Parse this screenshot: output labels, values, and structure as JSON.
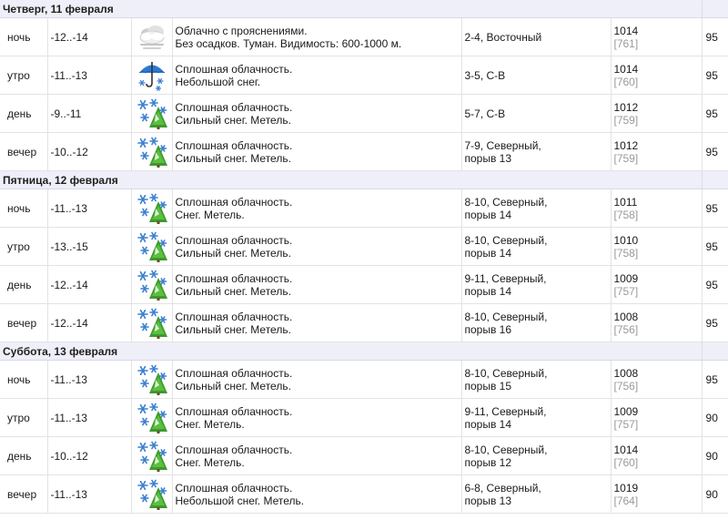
{
  "days": [
    {
      "title": "Четверг, 11 февраля",
      "rows": [
        {
          "time": "ночь",
          "temp": "-12..-14",
          "icon": "cloudy-fog-icon",
          "desc": [
            "Облачно с прояснениями.",
            "Без осадков. Туман. Видимость: 600-1000 м."
          ],
          "wind": [
            "2-4, Восточный"
          ],
          "pressure": "1014",
          "mmhg": "[761]",
          "humidity": "95"
        },
        {
          "time": "утро",
          "temp": "-11..-13",
          "icon": "umbrella-snow-icon",
          "desc": [
            "Сплошная облачность.",
            "Небольшой снег."
          ],
          "wind": [
            "3-5, С-В"
          ],
          "pressure": "1014",
          "mmhg": "[760]",
          "humidity": "95"
        },
        {
          "time": "день",
          "temp": "-9..-11",
          "icon": "snow-blizzard-icon",
          "desc": [
            "Сплошная облачность.",
            "Сильный снег. Метель."
          ],
          "wind": [
            "5-7, С-В"
          ],
          "pressure": "1012",
          "mmhg": "[759]",
          "humidity": "95"
        },
        {
          "time": "вечер",
          "temp": "-10..-12",
          "icon": "snow-blizzard-icon",
          "desc": [
            "Сплошная облачность.",
            "Сильный снег. Метель."
          ],
          "wind": [
            "7-9, Северный,",
            "порыв 13"
          ],
          "pressure": "1012",
          "mmhg": "[759]",
          "humidity": "95"
        }
      ]
    },
    {
      "title": "Пятница, 12 февраля",
      "rows": [
        {
          "time": "ночь",
          "temp": "-11..-13",
          "icon": "snow-blizzard-icon",
          "desc": [
            "Сплошная облачность.",
            "Снег. Метель."
          ],
          "wind": [
            "8-10, Северный,",
            "порыв 14"
          ],
          "pressure": "1011",
          "mmhg": "[758]",
          "humidity": "95"
        },
        {
          "time": "утро",
          "temp": "-13..-15",
          "icon": "snow-blizzard-icon",
          "desc": [
            "Сплошная облачность.",
            "Сильный снег. Метель."
          ],
          "wind": [
            "8-10, Северный,",
            "порыв 14"
          ],
          "pressure": "1010",
          "mmhg": "[758]",
          "humidity": "95"
        },
        {
          "time": "день",
          "temp": "-12..-14",
          "icon": "snow-blizzard-icon",
          "desc": [
            "Сплошная облачность.",
            "Сильный снег. Метель."
          ],
          "wind": [
            "9-11, Северный,",
            "порыв 14"
          ],
          "pressure": "1009",
          "mmhg": "[757]",
          "humidity": "95"
        },
        {
          "time": "вечер",
          "temp": "-12..-14",
          "icon": "snow-blizzard-icon",
          "desc": [
            "Сплошная облачность.",
            "Сильный снег. Метель."
          ],
          "wind": [
            "8-10, Северный,",
            "порыв 16"
          ],
          "pressure": "1008",
          "mmhg": "[756]",
          "humidity": "95"
        }
      ]
    },
    {
      "title": "Суббота, 13 февраля",
      "rows": [
        {
          "time": "ночь",
          "temp": "-11..-13",
          "icon": "snow-blizzard-icon",
          "desc": [
            "Сплошная облачность.",
            "Сильный снег. Метель."
          ],
          "wind": [
            "8-10, Северный,",
            "порыв 15"
          ],
          "pressure": "1008",
          "mmhg": "[756]",
          "humidity": "95"
        },
        {
          "time": "утро",
          "temp": "-11..-13",
          "icon": "snow-blizzard-icon",
          "desc": [
            "Сплошная облачность.",
            "Снег. Метель."
          ],
          "wind": [
            "9-11, Северный,",
            "порыв 14"
          ],
          "pressure": "1009",
          "mmhg": "[757]",
          "humidity": "90"
        },
        {
          "time": "день",
          "temp": "-10..-12",
          "icon": "snow-blizzard-icon",
          "desc": [
            "Сплошная облачность.",
            "Снег. Метель."
          ],
          "wind": [
            "8-10, Северный,",
            "порыв 12"
          ],
          "pressure": "1014",
          "mmhg": "[760]",
          "humidity": "90"
        },
        {
          "time": "вечер",
          "temp": "-11..-13",
          "icon": "snow-blizzard-icon",
          "desc": [
            "Сплошная облачность.",
            "Небольшой снег. Метель."
          ],
          "wind": [
            "6-8, Северный,",
            "порыв 13"
          ],
          "pressure": "1019",
          "mmhg": "[764]",
          "humidity": "90"
        }
      ]
    }
  ]
}
